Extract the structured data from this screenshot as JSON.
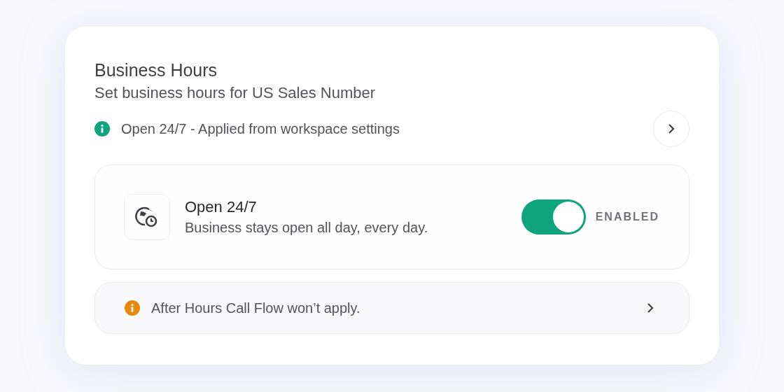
{
  "title": "Business Hours",
  "subtitle": "Set business hours for US Sales Number",
  "source_notice": {
    "kind": "info",
    "text": "Open 24/7 - Applied from workspace settings"
  },
  "setting": {
    "title": "Open 24/7",
    "description": "Business stays open all day, every day.",
    "on": true,
    "state_label": "ENABLED"
  },
  "footer_notice": {
    "kind": "warning",
    "text": "After Hours Call Flow won’t apply."
  }
}
